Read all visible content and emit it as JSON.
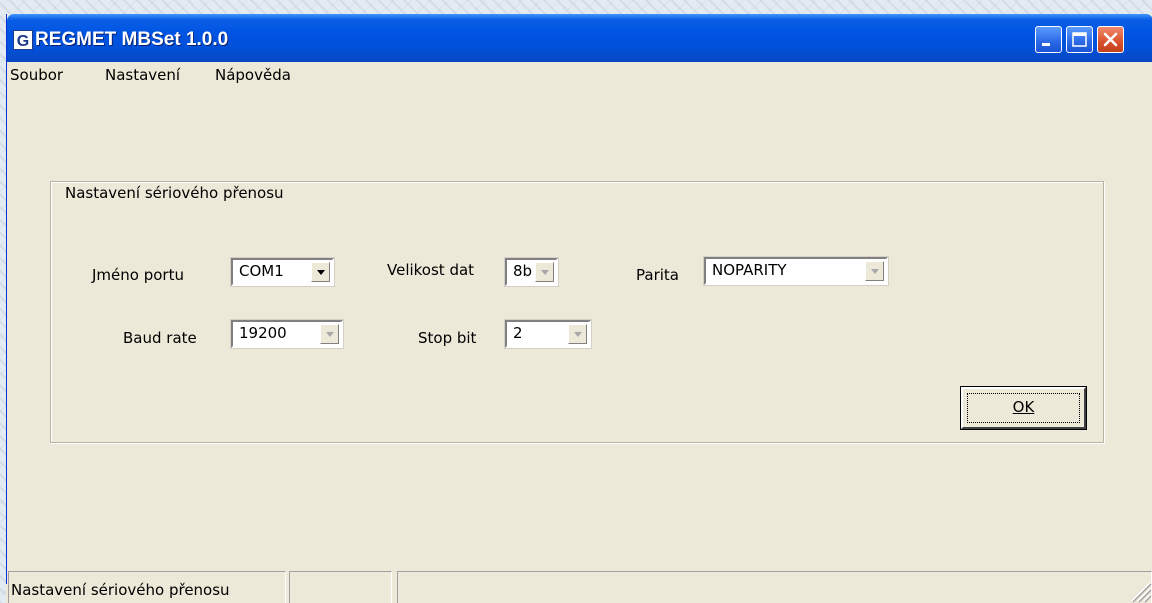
{
  "window": {
    "icon_letter": "G",
    "title": "REGMET MBSet 1.0.0"
  },
  "menu": {
    "items": [
      "Soubor",
      "Nastavení",
      "Nápověda"
    ]
  },
  "group": {
    "title": "Nastavení sériového přenosu"
  },
  "fields": {
    "port_name": {
      "label": "Jméno portu",
      "value": "COM1",
      "enabled": true
    },
    "data_size": {
      "label": "Velikost dat",
      "value": "8b",
      "enabled": false
    },
    "parity": {
      "label": "Parita",
      "value": "NOPARITY",
      "enabled": false
    },
    "baud_rate": {
      "label": "Baud rate",
      "value": "19200",
      "enabled": false
    },
    "stop_bit": {
      "label": "Stop bit",
      "value": "2",
      "enabled": false
    }
  },
  "ok_button": {
    "label": "OK"
  },
  "statusbar": {
    "panel1": "Nastavení sériového přenosu",
    "panel2": "",
    "panel3": ""
  },
  "colors": {
    "titlebar": "#0054e3",
    "dialog_bg": "#ece9d8",
    "close_button": "#d9502c"
  }
}
